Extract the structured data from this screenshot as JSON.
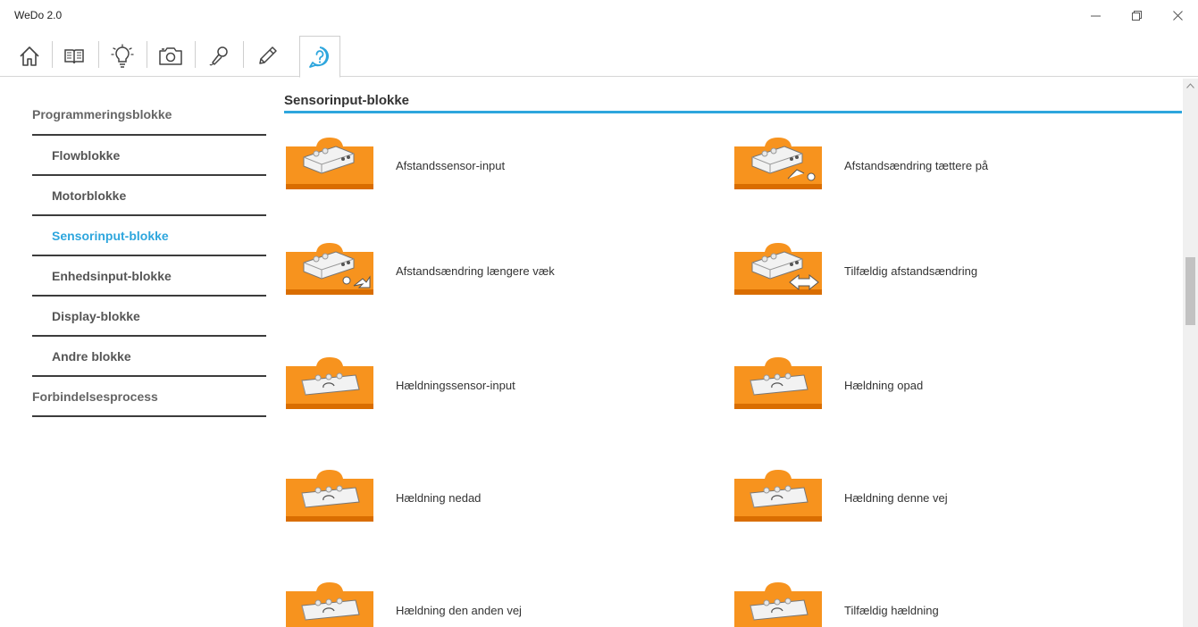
{
  "window": {
    "title": "WeDo 2.0"
  },
  "toolbar": {
    "items": [
      {
        "name": "home-icon"
      },
      {
        "name": "book-icon"
      },
      {
        "name": "lightbulb-icon"
      },
      {
        "name": "camera-icon"
      },
      {
        "name": "microphone-icon"
      },
      {
        "name": "pencil-icon"
      },
      {
        "name": "help-icon",
        "active": true
      }
    ],
    "accent_color": "#2ea6dd"
  },
  "sidebar": {
    "items": [
      {
        "label": "Programmeringsblokke",
        "level": 0
      },
      {
        "label": "Flowblokke",
        "level": 1
      },
      {
        "label": "Motorblokke",
        "level": 1
      },
      {
        "label": "Sensorinput-blokke",
        "level": 1,
        "active": true
      },
      {
        "label": "Enhedsinput-blokke",
        "level": 1
      },
      {
        "label": "Display-blokke",
        "level": 1
      },
      {
        "label": "Andre blokke",
        "level": 1
      },
      {
        "label": "Forbindelsesprocess",
        "level": 0
      }
    ]
  },
  "main": {
    "title": "Sensorinput-blokke",
    "blocks": [
      {
        "label": "Afstandssensor-input",
        "icon": "motion-sensor-icon"
      },
      {
        "label": "Afstandsændring tættere på",
        "icon": "motion-sensor-closer-icon"
      },
      {
        "label": "Afstandsændring længere væk",
        "icon": "motion-sensor-farther-icon"
      },
      {
        "label": "Tilfældig afstandsændring",
        "icon": "motion-sensor-any-change-icon"
      },
      {
        "label": "Hældningssensor-input",
        "icon": "tilt-sensor-icon"
      },
      {
        "label": "Hældning opad",
        "icon": "tilt-up-icon"
      },
      {
        "label": "Hældning nedad",
        "icon": "tilt-down-icon"
      },
      {
        "label": "Hældning denne vej",
        "icon": "tilt-this-way-icon"
      },
      {
        "label": "Hældning den anden vej",
        "icon": "tilt-that-way-icon"
      },
      {
        "label": "Tilfældig hældning",
        "icon": "tilt-any-icon"
      }
    ],
    "block_color": "#f7931e"
  }
}
